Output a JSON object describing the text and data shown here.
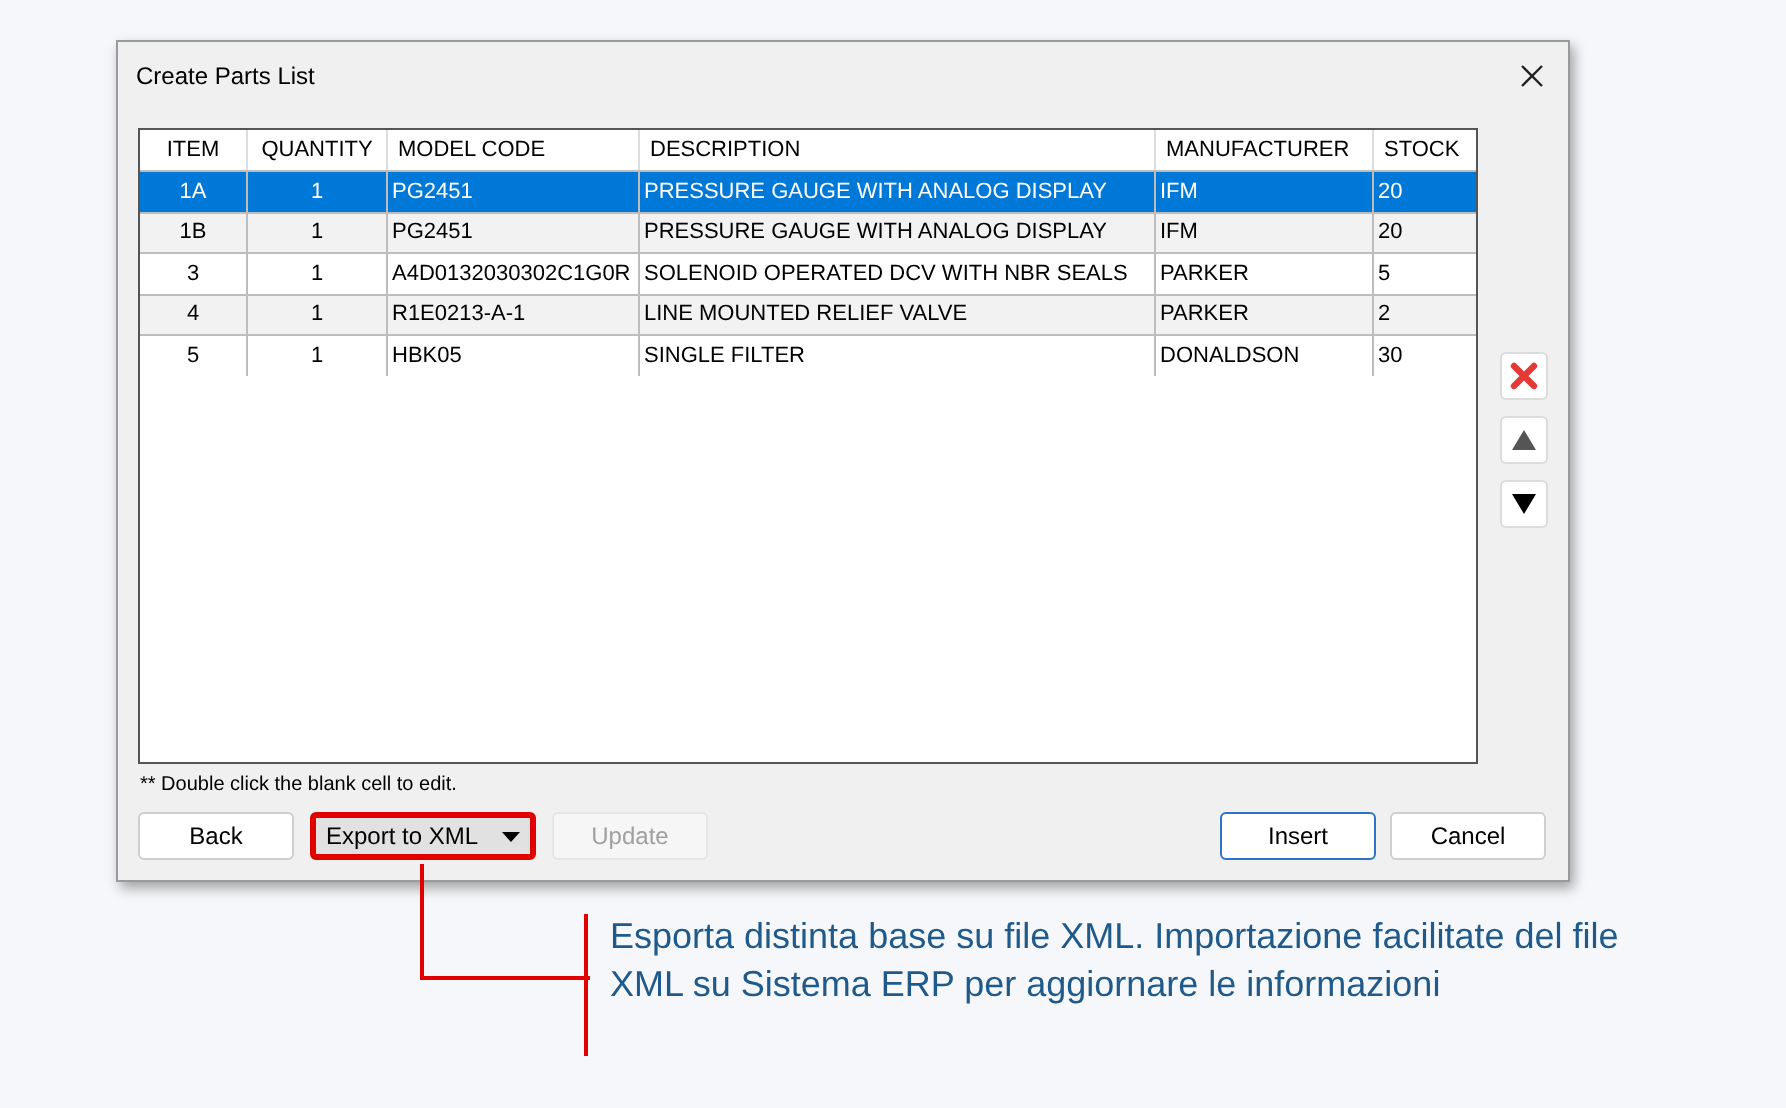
{
  "window": {
    "title": "Create Parts List"
  },
  "table": {
    "columns": [
      "ITEM",
      "QUANTITY",
      "MODEL CODE",
      "DESCRIPTION",
      "MANUFACTURER",
      "STOCK"
    ],
    "rows": [
      {
        "selected": true,
        "cells": [
          "1A",
          "1",
          "PG2451",
          "PRESSURE GAUGE WITH ANALOG DISPLAY",
          "IFM",
          "20"
        ]
      },
      {
        "selected": false,
        "cells": [
          "1B",
          "1",
          "PG2451",
          "PRESSURE GAUGE WITH ANALOG DISPLAY",
          "IFM",
          "20"
        ]
      },
      {
        "selected": false,
        "cells": [
          "3",
          "1",
          "A4D0132030302C1G0R",
          "SOLENOID OPERATED DCV WITH NBR SEALS",
          "PARKER",
          "5"
        ]
      },
      {
        "selected": false,
        "cells": [
          "4",
          "1",
          "R1E0213-A-1",
          "LINE MOUNTED RELIEF VALVE",
          "PARKER",
          "2"
        ]
      },
      {
        "selected": false,
        "cells": [
          "5",
          "1",
          "HBK05",
          "SINGLE FILTER",
          "DONALDSON",
          "30"
        ]
      }
    ]
  },
  "side_buttons": [
    {
      "kind": "delete"
    },
    {
      "kind": "up"
    },
    {
      "kind": "down"
    }
  ],
  "note": "** Double click the blank cell to edit.",
  "buttons": [
    {
      "label": "Back",
      "disabled": false,
      "default": false,
      "highlighted": false,
      "dropdown": false
    },
    {
      "label": "Export to XML",
      "disabled": false,
      "default": false,
      "highlighted": true,
      "dropdown": true
    },
    {
      "label": "Update",
      "disabled": true,
      "default": false,
      "highlighted": false,
      "dropdown": false
    },
    {
      "label": "Insert",
      "disabled": false,
      "default": true,
      "highlighted": false,
      "dropdown": false
    },
    {
      "label": "Cancel",
      "disabled": false,
      "default": false,
      "highlighted": false,
      "dropdown": false
    }
  ],
  "annotation": "Esporta distinta base su file XML. Importazione facilitate del file XML su Sistema ERP per aggiornare le informazioni"
}
